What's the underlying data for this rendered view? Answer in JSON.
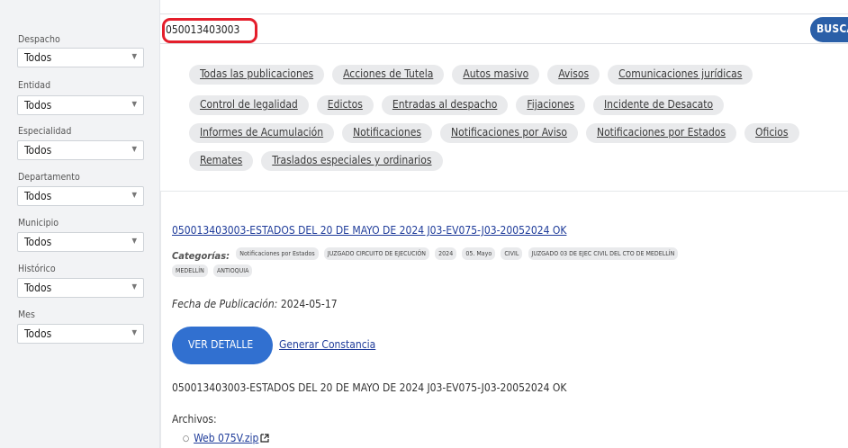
{
  "sidebar": {
    "filters": [
      {
        "label": "Despacho",
        "value": "Todos"
      },
      {
        "label": "Entidad",
        "value": "Todos"
      },
      {
        "label": "Especialidad",
        "value": "Todos"
      },
      {
        "label": "Departamento",
        "value": "Todos"
      },
      {
        "label": "Municipio",
        "value": "Todos"
      },
      {
        "label": "Histórico",
        "value": "Todos"
      },
      {
        "label": "Mes",
        "value": "Todos"
      }
    ]
  },
  "search": {
    "value": "050013403003",
    "button_label": "BUSCA"
  },
  "categories": {
    "rows": [
      [
        "Todas las publicaciones",
        "Acciones de Tutela",
        "Autos masivo",
        "Avisos",
        "Comunicaciones jurídicas"
      ],
      [
        "Control de legalidad",
        "Edictos",
        "Entradas al despacho",
        "Fijaciones",
        "Incidente de Desacato"
      ],
      [
        "Informes de Acumulación",
        "Notificaciones",
        "Notificaciones por Aviso",
        "Notificaciones por Estados",
        "Oficios"
      ],
      [
        "Remates",
        "Traslados especiales y ordinarios"
      ]
    ]
  },
  "result": {
    "title": "050013403003-ESTADOS DEL 20 DE MAYO DE 2024 J03-EV075-J03-20052024 OK",
    "categorias_label": "Categorías:",
    "badges": [
      "Notificaciones por Estados",
      "JUZGADO CIRCUITO DE EJECUCIÓN",
      "2024",
      "05. Mayo",
      "CIVIL",
      "JUZGADO 03 DE EJEC CIVIL DEL CTO DE MEDELLÍN",
      "MEDELLÍN",
      "ANTIOQUIA"
    ],
    "pub_date_label": "Fecha de Publicación:",
    "pub_date_value": "2024-05-17",
    "detail_button": "VER DETALLE",
    "constancia_link": "Generar Constancia",
    "description": "050013403003-ESTADOS DEL 20 DE MAYO DE 2024 J03-EV075-J03-20052024 OK",
    "files_label": "Archivos:",
    "files": [
      {
        "name": "Web 075V.zip"
      }
    ]
  },
  "colors": {
    "accent_blue": "#3170d0",
    "search_button": "#2a5fa8",
    "highlight_red": "#e41e2b",
    "link": "#1f3c9a"
  }
}
